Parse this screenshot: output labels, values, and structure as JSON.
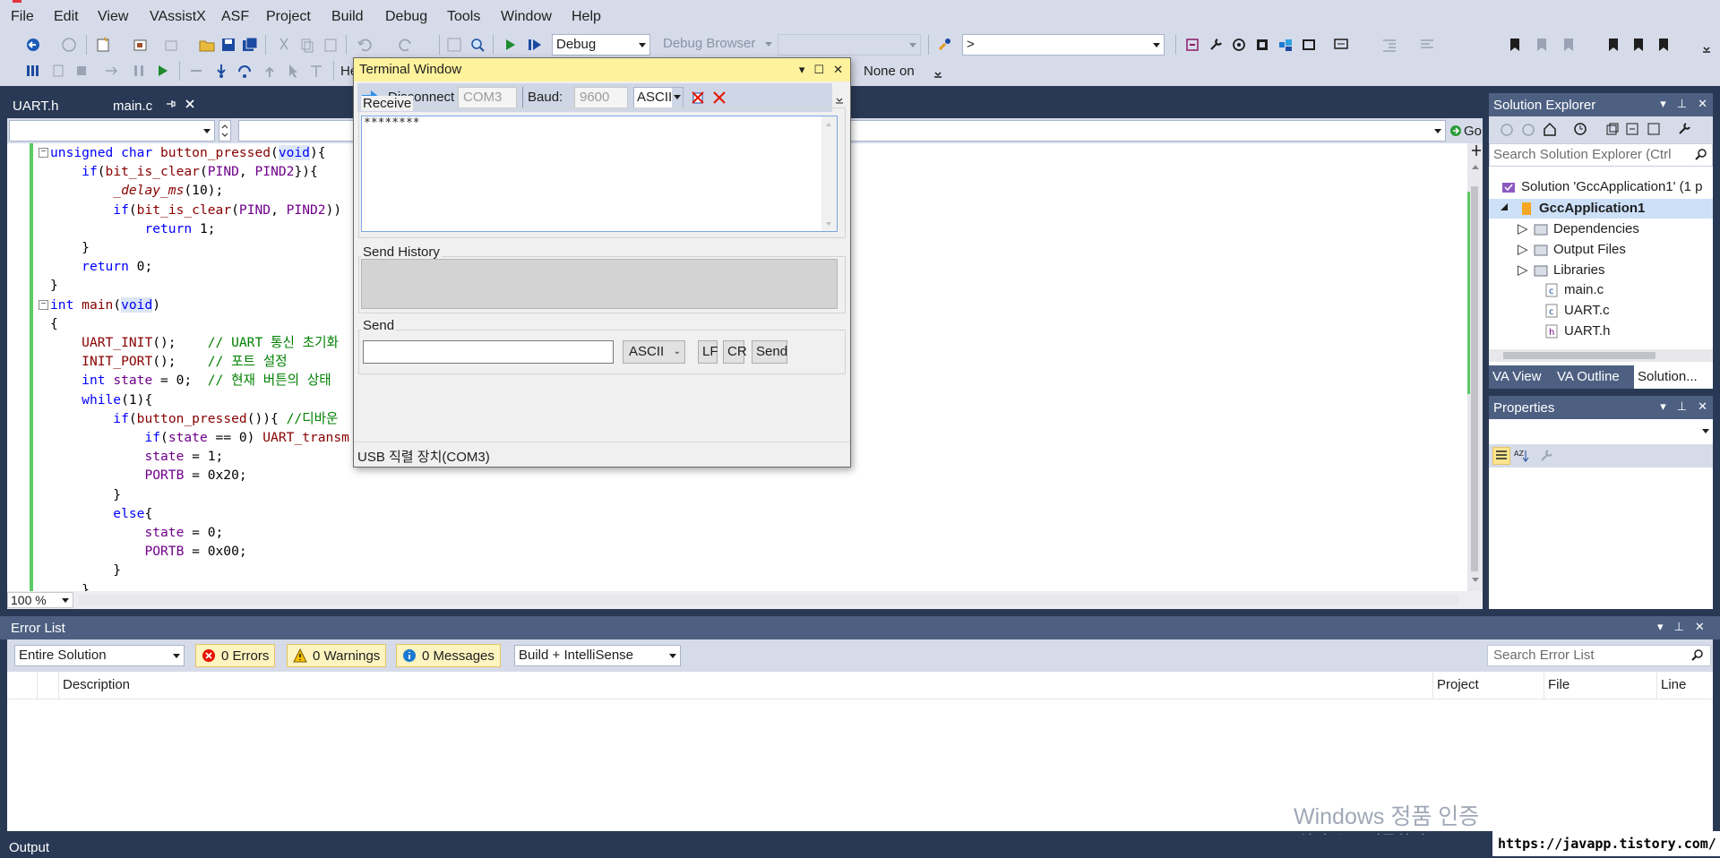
{
  "menu": [
    "File",
    "Edit",
    "View",
    "VAssistX",
    "ASF",
    "Project",
    "Build",
    "Debug",
    "Tools",
    "Window",
    "Help"
  ],
  "toolbar": {
    "config": "Debug",
    "debug_browser": "Debug Browser",
    "find_box": ">",
    "row2_label": "He",
    "none_on": "None on"
  },
  "tabs": [
    {
      "label": "UART.h"
    },
    {
      "label": "main.c"
    }
  ],
  "navbar": {
    "go_label": "Go"
  },
  "code": {
    "lines": [
      [
        [
          "kw",
          "unsigned char "
        ],
        [
          "fn",
          "button_pressed"
        ],
        [
          "nm",
          "("
        ],
        [
          "kwh",
          "void"
        ],
        [
          "nm",
          "){"
        ]
      ],
      [
        [
          "nm",
          "    "
        ],
        [
          "kw",
          "if"
        ],
        [
          "nm",
          "("
        ],
        [
          "fn",
          "bit_is_clear"
        ],
        [
          "nm",
          "("
        ],
        [
          "mac",
          "PIND"
        ],
        [
          "nm",
          ", "
        ],
        [
          "mac",
          "PIND2"
        ],
        [
          "nm",
          "}){"
        ]
      ],
      [
        [
          "nm",
          "        "
        ],
        [
          "itf",
          "_delay_ms"
        ],
        [
          "nm",
          "(10);"
        ]
      ],
      [
        [
          "nm",
          "        "
        ],
        [
          "kw",
          "if"
        ],
        [
          "nm",
          "("
        ],
        [
          "fn",
          "bit_is_clear"
        ],
        [
          "nm",
          "("
        ],
        [
          "mac",
          "PIND"
        ],
        [
          "nm",
          ", "
        ],
        [
          "mac",
          "PIND2"
        ],
        [
          "nm",
          "))"
        ]
      ],
      [
        [
          "nm",
          "            "
        ],
        [
          "kw",
          "return"
        ],
        [
          "nm",
          " 1;"
        ]
      ],
      [
        [
          "nm",
          "    }"
        ]
      ],
      [
        [
          "nm",
          "    "
        ],
        [
          "kw",
          "return"
        ],
        [
          "nm",
          " 0;"
        ]
      ],
      [
        [
          "nm",
          "}"
        ]
      ],
      [
        [
          "kw",
          "int "
        ],
        [
          "fn",
          "main"
        ],
        [
          "nm",
          "("
        ],
        [
          "kwh",
          "void"
        ],
        [
          "nm",
          ")"
        ]
      ],
      [
        [
          "nm",
          "{"
        ]
      ],
      [
        [
          "nm",
          "    "
        ],
        [
          "fn",
          "UART_INIT"
        ],
        [
          "nm",
          "();    "
        ],
        [
          "cm",
          "// UART 통신 초기화"
        ]
      ],
      [
        [
          "nm",
          "    "
        ],
        [
          "fn",
          "INIT_PORT"
        ],
        [
          "nm",
          "();    "
        ],
        [
          "cm",
          "// 포트 설정"
        ]
      ],
      [
        [
          "nm",
          "    "
        ],
        [
          "kw",
          "int "
        ],
        [
          "mac",
          "state"
        ],
        [
          "nm",
          " = 0;  "
        ],
        [
          "cm",
          "// 현재 버튼의 상태"
        ]
      ],
      [
        [
          "nm",
          "    "
        ],
        [
          "kw",
          "while"
        ],
        [
          "nm",
          "(1){"
        ]
      ],
      [
        [
          "nm",
          "        "
        ],
        [
          "kw",
          "if"
        ],
        [
          "nm",
          "("
        ],
        [
          "fn",
          "button_pressed"
        ],
        [
          "nm",
          "()){ "
        ],
        [
          "cm",
          "//디바운"
        ]
      ],
      [
        [
          "nm",
          "            "
        ],
        [
          "kw",
          "if"
        ],
        [
          "nm",
          "("
        ],
        [
          "mac",
          "state"
        ],
        [
          "nm",
          " == 0) "
        ],
        [
          "fn",
          "UART_transm"
        ]
      ],
      [
        [
          "nm",
          "            "
        ],
        [
          "mac",
          "state"
        ],
        [
          "nm",
          " = 1;"
        ]
      ],
      [
        [
          "nm",
          "            "
        ],
        [
          "mac",
          "PORTB"
        ],
        [
          "nm",
          " = 0x20;"
        ]
      ],
      [
        [
          "nm",
          "        }"
        ]
      ],
      [
        [
          "nm",
          "        "
        ],
        [
          "kw",
          "else"
        ],
        [
          "nm",
          "{"
        ]
      ],
      [
        [
          "nm",
          "            "
        ],
        [
          "mac",
          "state"
        ],
        [
          "nm",
          " = 0;"
        ]
      ],
      [
        [
          "nm",
          "            "
        ],
        [
          "mac",
          "PORTB"
        ],
        [
          "nm",
          " = 0x00;"
        ]
      ],
      [
        [
          "nm",
          "        }"
        ]
      ],
      [
        [
          "nm",
          "    }"
        ]
      ]
    ]
  },
  "zoom": "100 %",
  "solution_explorer": {
    "title": "Solution Explorer",
    "search_placeholder": "Search Solution Explorer (Ctrl",
    "solution": "Solution 'GccApplication1' (1 p",
    "project": "GccApplication1",
    "items": [
      "Dependencies",
      "Output Files",
      "Libraries",
      "main.c",
      "UART.c",
      "UART.h"
    ],
    "tabs": [
      "VA View",
      "VA Outline",
      "Solution..."
    ]
  },
  "properties": {
    "title": "Properties"
  },
  "error_list": {
    "title": "Error List",
    "scope": "Entire Solution",
    "errors": "0 Errors",
    "warnings": "0 Warnings",
    "messages": "0 Messages",
    "build_filter": "Build + IntelliSense",
    "search_placeholder": "Search Error List",
    "columns": [
      "Description",
      "Project",
      "File",
      "Line"
    ]
  },
  "terminal": {
    "title": "Terminal Window",
    "disconnect": "Disconnect",
    "port": "COM3",
    "baud_label": "Baud:",
    "baud": "9600",
    "mode": "ASCII",
    "receive_label": "Receive",
    "receive_text": "********",
    "history_label": "Send History",
    "send_label": "Send",
    "send_mode": "ASCII",
    "lf": "LF",
    "cr": "CR",
    "send_button": "Send",
    "status": "USB 직렬 장치(COM3)"
  },
  "watermark": {
    "line1": "Windows 정품 인증",
    "line2": "[설정]으로 이동하여 Windo",
    "blog": "https://javapp.tistory.com/"
  },
  "output_label": "Output",
  "colors": {
    "background": "#293955",
    "chrome": "#d6dbe9",
    "panel_title": "#4d6082",
    "terminal_title": "#fff29d",
    "keyword": "#0000ff",
    "function": "#880000",
    "macro": "#6f008a",
    "comment": "#008000"
  }
}
